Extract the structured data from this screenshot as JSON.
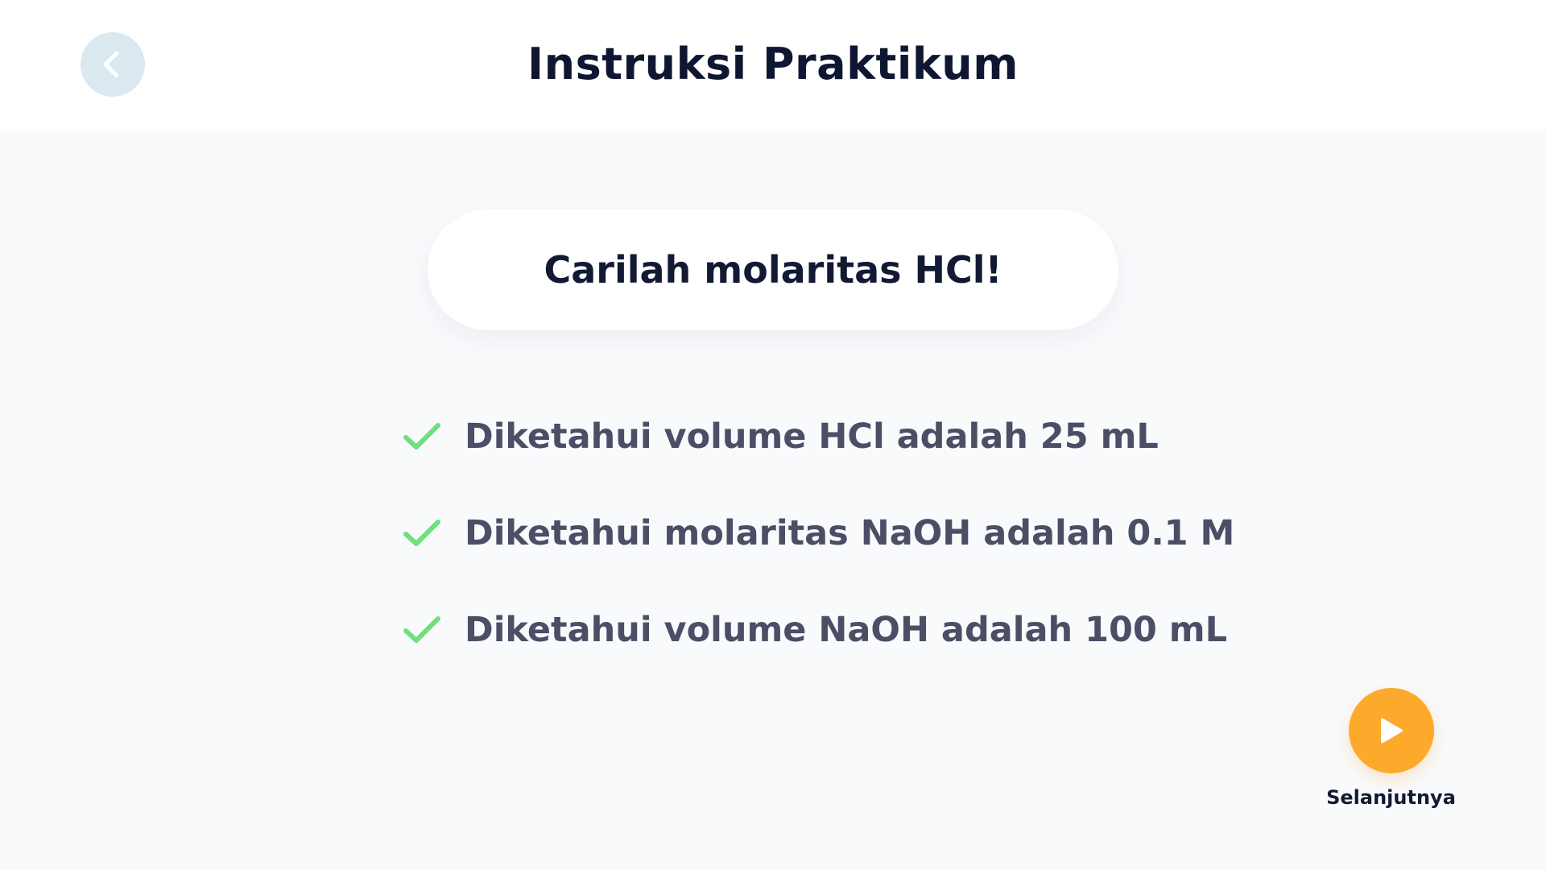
{
  "header": {
    "title": "Instruksi Praktikum",
    "back_icon": "chevron-left-icon"
  },
  "task": {
    "prompt": "Carilah molaritas HCl!"
  },
  "facts": [
    {
      "text": "Diketahui volume HCl adalah 25 mL",
      "icon": "check-icon"
    },
    {
      "text": "Diketahui molaritas NaOH adalah 0.1 M",
      "icon": "check-icon"
    },
    {
      "text": "Diketahui volume NaOH adalah 100 mL",
      "icon": "check-icon"
    }
  ],
  "next": {
    "label": "Selanjutnya",
    "icon": "play-icon"
  },
  "colors": {
    "accent": "#fda92c",
    "check": "#6ee07e",
    "back_button": "#dce8f0",
    "title": "#0f1632",
    "body_text": "#4a4f66",
    "background": "#f9fafc"
  }
}
